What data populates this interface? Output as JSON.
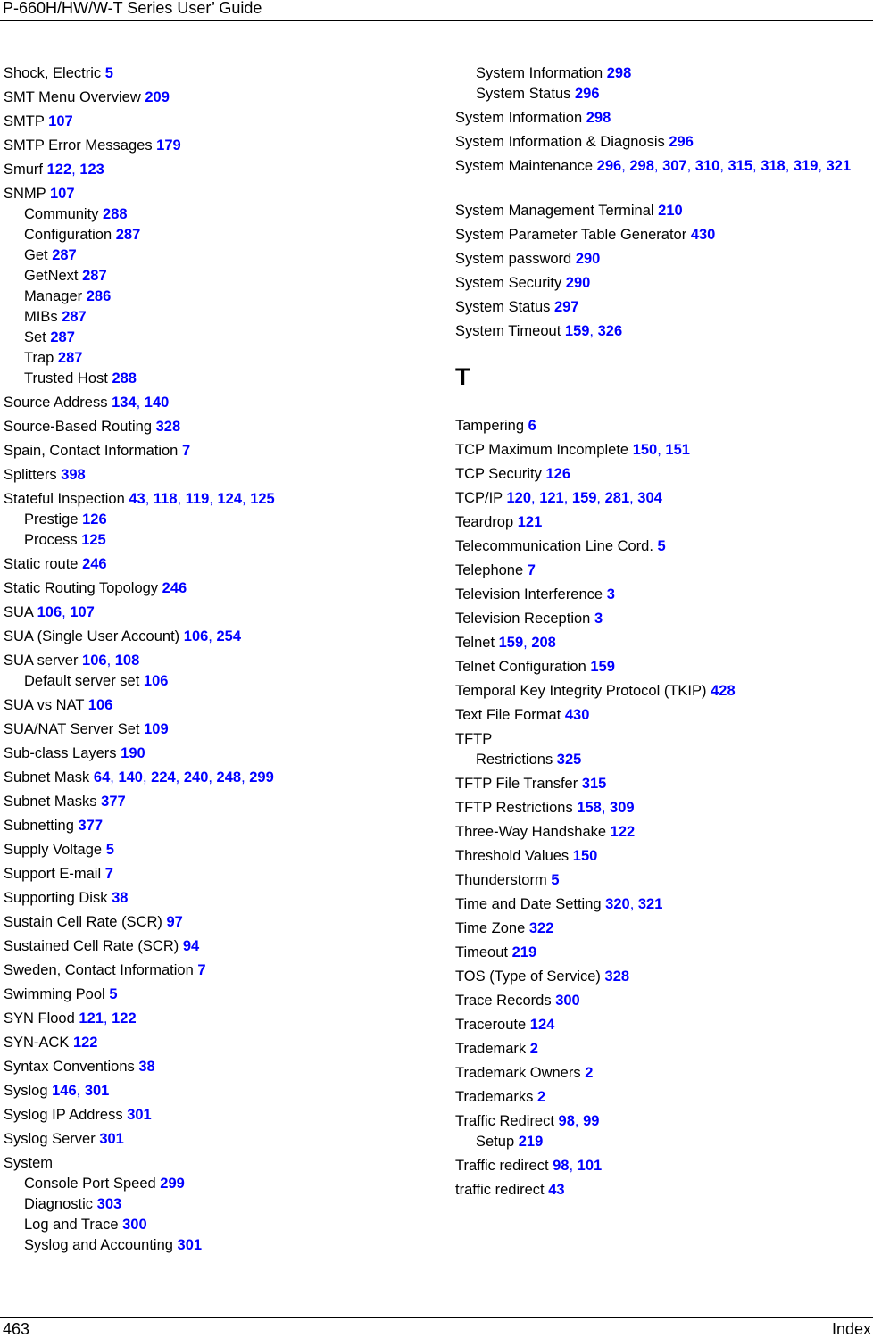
{
  "header": {
    "title": "P-660H/HW/W-T Series User’ Guide"
  },
  "footer": {
    "page_number": "463",
    "section": "Index"
  },
  "colors": {
    "page_ref": "#0000ff",
    "text": "#000000"
  },
  "left_column": [
    {
      "term": "Shock, Electric",
      "pages": [
        "5"
      ],
      "level": 0
    },
    {
      "term": "SMT Menu Overview",
      "pages": [
        "209"
      ],
      "level": 0
    },
    {
      "term": "SMTP",
      "pages": [
        "107"
      ],
      "level": 0
    },
    {
      "term": "SMTP Error Messages",
      "pages": [
        "179"
      ],
      "level": 0
    },
    {
      "term": "Smurf",
      "pages": [
        "122",
        "123"
      ],
      "level": 0
    },
    {
      "term": "SNMP",
      "pages": [
        "107"
      ],
      "level": 0
    },
    {
      "term": "Community",
      "pages": [
        "288"
      ],
      "level": 1
    },
    {
      "term": "Configuration",
      "pages": [
        "287"
      ],
      "level": 1
    },
    {
      "term": "Get",
      "pages": [
        "287"
      ],
      "level": 1
    },
    {
      "term": "GetNext",
      "pages": [
        "287"
      ],
      "level": 1
    },
    {
      "term": "Manager",
      "pages": [
        "286"
      ],
      "level": 1
    },
    {
      "term": "MIBs",
      "pages": [
        "287"
      ],
      "level": 1
    },
    {
      "term": "Set",
      "pages": [
        "287"
      ],
      "level": 1
    },
    {
      "term": "Trap",
      "pages": [
        "287"
      ],
      "level": 1
    },
    {
      "term": "Trusted Host",
      "pages": [
        "288"
      ],
      "level": 1
    },
    {
      "term": "Source Address",
      "pages": [
        "134",
        "140"
      ],
      "level": 0
    },
    {
      "term": "Source-Based Routing",
      "pages": [
        "328"
      ],
      "level": 0
    },
    {
      "term": "Spain, Contact Information",
      "pages": [
        "7"
      ],
      "level": 0
    },
    {
      "term": "Splitters",
      "pages": [
        "398"
      ],
      "level": 0
    },
    {
      "term": "Stateful Inspection",
      "pages": [
        "43",
        "118",
        "119",
        "124",
        "125"
      ],
      "level": 0
    },
    {
      "term": "Prestige",
      "pages": [
        "126"
      ],
      "level": 1
    },
    {
      "term": "Process",
      "pages": [
        "125"
      ],
      "level": 1
    },
    {
      "term": "Static route",
      "pages": [
        "246"
      ],
      "level": 0
    },
    {
      "term": "Static Routing Topology",
      "pages": [
        "246"
      ],
      "level": 0
    },
    {
      "term": "SUA",
      "pages": [
        "106",
        "107"
      ],
      "level": 0
    },
    {
      "term": "SUA (Single User Account)",
      "pages": [
        "106",
        "254"
      ],
      "level": 0
    },
    {
      "term": "SUA server",
      "pages": [
        "106",
        "108"
      ],
      "level": 0
    },
    {
      "term": "Default server set",
      "pages": [
        "106"
      ],
      "level": 1
    },
    {
      "term": "SUA vs NAT",
      "pages": [
        "106"
      ],
      "level": 0
    },
    {
      "term": "SUA/NAT Server Set",
      "pages": [
        "109"
      ],
      "level": 0
    },
    {
      "term": "Sub-class Layers",
      "pages": [
        "190"
      ],
      "level": 0
    },
    {
      "term": "Subnet Mask",
      "pages": [
        "64",
        "140",
        "224",
        "240",
        "248",
        "299"
      ],
      "level": 0
    },
    {
      "term": "Subnet Masks",
      "pages": [
        "377"
      ],
      "level": 0
    },
    {
      "term": "Subnetting",
      "pages": [
        "377"
      ],
      "level": 0
    },
    {
      "term": "Supply Voltage",
      "pages": [
        "5"
      ],
      "level": 0
    },
    {
      "term": "Support E-mail",
      "pages": [
        "7"
      ],
      "level": 0
    },
    {
      "term": "Supporting Disk",
      "pages": [
        "38"
      ],
      "level": 0
    },
    {
      "term": "Sustain Cell Rate (SCR)",
      "pages": [
        "97"
      ],
      "level": 0
    },
    {
      "term": "Sustained Cell Rate (SCR)",
      "pages": [
        "94"
      ],
      "level": 0
    },
    {
      "term": "Sweden, Contact Information",
      "pages": [
        "7"
      ],
      "level": 0
    },
    {
      "term": "Swimming Pool",
      "pages": [
        "5"
      ],
      "level": 0
    },
    {
      "term": "SYN Flood",
      "pages": [
        "121",
        "122"
      ],
      "level": 0
    },
    {
      "term": "SYN-ACK",
      "pages": [
        "122"
      ],
      "level": 0
    },
    {
      "term": "Syntax Conventions",
      "pages": [
        "38"
      ],
      "level": 0
    },
    {
      "term": "Syslog",
      "pages": [
        "146",
        "301"
      ],
      "level": 0
    },
    {
      "term": "Syslog IP Address",
      "pages": [
        "301"
      ],
      "level": 0
    },
    {
      "term": "Syslog Server",
      "pages": [
        "301"
      ],
      "level": 0
    },
    {
      "term": "System",
      "pages": [],
      "level": 0
    },
    {
      "term": "Console Port Speed",
      "pages": [
        "299"
      ],
      "level": 1
    },
    {
      "term": "Diagnostic",
      "pages": [
        "303"
      ],
      "level": 1
    },
    {
      "term": "Log and Trace",
      "pages": [
        "300"
      ],
      "level": 1
    },
    {
      "term": "Syslog and Accounting",
      "pages": [
        "301"
      ],
      "level": 1
    }
  ],
  "right_column": [
    {
      "term": "System Information",
      "pages": [
        "298"
      ],
      "level": 1
    },
    {
      "term": "System Status",
      "pages": [
        "296"
      ],
      "level": 1
    },
    {
      "term": "System Information",
      "pages": [
        "298"
      ],
      "level": 0
    },
    {
      "term": "System Information & Diagnosis",
      "pages": [
        "296"
      ],
      "level": 0
    },
    {
      "term": "System Maintenance",
      "pages": [
        "296",
        "298",
        "307",
        "310",
        "315",
        "318",
        "319",
        "321"
      ],
      "level": 0,
      "wrap": true
    },
    {
      "term": "System Management Terminal",
      "pages": [
        "210"
      ],
      "level": 0
    },
    {
      "term": "System Parameter Table Generator",
      "pages": [
        "430"
      ],
      "level": 0
    },
    {
      "term": "System password",
      "pages": [
        "290"
      ],
      "level": 0
    },
    {
      "term": "System Security",
      "pages": [
        "290"
      ],
      "level": 0
    },
    {
      "term": "System Status",
      "pages": [
        "297"
      ],
      "level": 0
    },
    {
      "term": "System Timeout",
      "pages": [
        "159",
        "326"
      ],
      "level": 0
    },
    {
      "letter": "T"
    },
    {
      "term": "Tampering",
      "pages": [
        "6"
      ],
      "level": 0
    },
    {
      "term": "TCP Maximum Incomplete",
      "pages": [
        "150",
        "151"
      ],
      "level": 0
    },
    {
      "term": "TCP Security",
      "pages": [
        "126"
      ],
      "level": 0
    },
    {
      "term": "TCP/IP",
      "pages": [
        "120",
        "121",
        "159",
        "281",
        "304"
      ],
      "level": 0
    },
    {
      "term": "Teardrop",
      "pages": [
        "121"
      ],
      "level": 0
    },
    {
      "term": "Telecommunication Line Cord.",
      "pages": [
        "5"
      ],
      "level": 0
    },
    {
      "term": "Telephone",
      "pages": [
        "7"
      ],
      "level": 0
    },
    {
      "term": "Television Interference",
      "pages": [
        "3"
      ],
      "level": 0
    },
    {
      "term": "Television Reception",
      "pages": [
        "3"
      ],
      "level": 0
    },
    {
      "term": "Telnet",
      "pages": [
        "159",
        "208"
      ],
      "level": 0
    },
    {
      "term": "Telnet Configuration",
      "pages": [
        "159"
      ],
      "level": 0
    },
    {
      "term": "Temporal Key Integrity Protocol (TKIP)",
      "pages": [
        "428"
      ],
      "level": 0
    },
    {
      "term": "Text File Format",
      "pages": [
        "430"
      ],
      "level": 0
    },
    {
      "term": "TFTP",
      "pages": [],
      "level": 0
    },
    {
      "term": "Restrictions",
      "pages": [
        "325"
      ],
      "level": 1
    },
    {
      "term": "TFTP File Transfer",
      "pages": [
        "315"
      ],
      "level": 0
    },
    {
      "term": "TFTP Restrictions",
      "pages": [
        "158",
        "309"
      ],
      "level": 0
    },
    {
      "term": "Three-Way Handshake",
      "pages": [
        "122"
      ],
      "level": 0
    },
    {
      "term": "Threshold Values",
      "pages": [
        "150"
      ],
      "level": 0
    },
    {
      "term": "Thunderstorm",
      "pages": [
        "5"
      ],
      "level": 0
    },
    {
      "term": "Time and Date Setting",
      "pages": [
        "320",
        "321"
      ],
      "level": 0
    },
    {
      "term": "Time Zone",
      "pages": [
        "322"
      ],
      "level": 0
    },
    {
      "term": "Timeout",
      "pages": [
        "219"
      ],
      "level": 0
    },
    {
      "term": "TOS (Type of Service)",
      "pages": [
        "328"
      ],
      "level": 0
    },
    {
      "term": "Trace Records",
      "pages": [
        "300"
      ],
      "level": 0
    },
    {
      "term": "Traceroute",
      "pages": [
        "124"
      ],
      "level": 0
    },
    {
      "term": "Trademark",
      "pages": [
        "2"
      ],
      "level": 0
    },
    {
      "term": "Trademark Owners",
      "pages": [
        "2"
      ],
      "level": 0
    },
    {
      "term": "Trademarks",
      "pages": [
        "2"
      ],
      "level": 0
    },
    {
      "term": "Traffic Redirect",
      "pages": [
        "98",
        "99"
      ],
      "level": 0
    },
    {
      "term": "Setup",
      "pages": [
        "219"
      ],
      "level": 1
    },
    {
      "term": "Traffic redirect",
      "pages": [
        "98",
        "101"
      ],
      "level": 0
    },
    {
      "term": "traffic redirect",
      "pages": [
        "43"
      ],
      "level": 0
    }
  ]
}
